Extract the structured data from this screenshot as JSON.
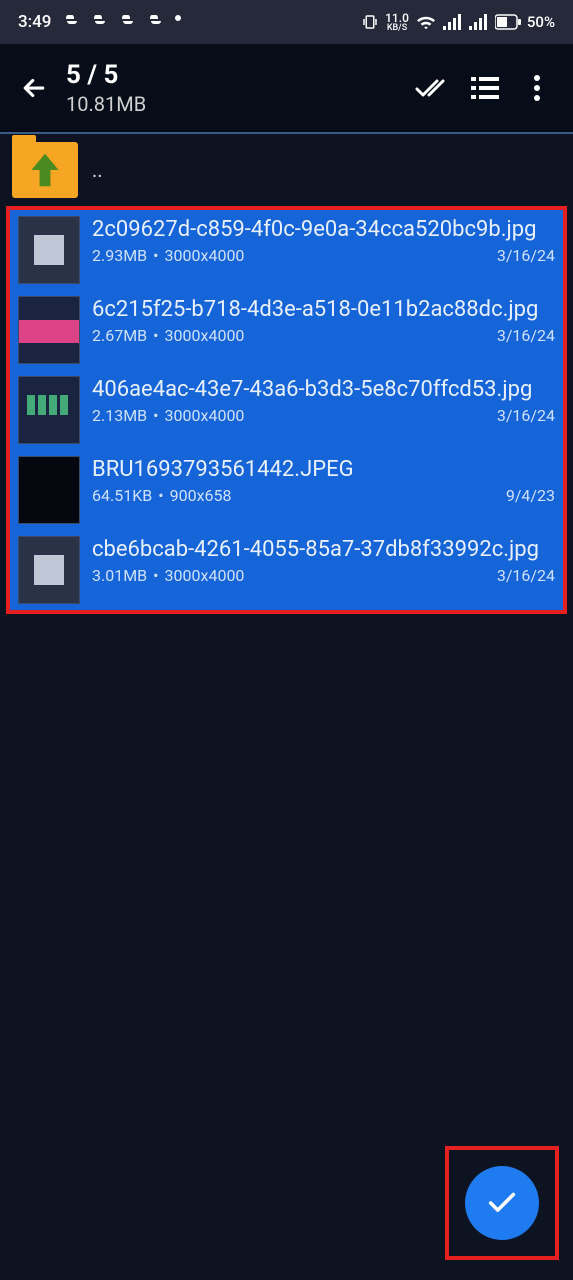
{
  "status": {
    "time": "3:49",
    "net_speed": "11.0",
    "net_unit": "KB/S",
    "battery": "50%"
  },
  "header": {
    "selection_count": "5 / 5",
    "total_size": "10.81MB"
  },
  "up_label": "..",
  "files": [
    {
      "name": "2c09627d-c859-4f0c-9e0a-34cca520bc9b.jpg",
      "size": "2.93MB",
      "dims": "3000x4000",
      "date": "3/16/24",
      "thumb": "qr"
    },
    {
      "name": "6c215f25-b718-4d3e-a518-0e11b2ac88dc.jpg",
      "size": "2.67MB",
      "dims": "3000x4000",
      "date": "3/16/24",
      "thumb": "photo"
    },
    {
      "name": "406ae4ac-43e7-43a6-b3d3-5e8c70ffcd53.jpg",
      "size": "2.13MB",
      "dims": "3000x4000",
      "date": "3/16/24",
      "thumb": "grid"
    },
    {
      "name": "BRU1693793561442.JPEG",
      "size": "64.51KB",
      "dims": "900x658",
      "date": "9/4/23",
      "thumb": "dark"
    },
    {
      "name": "cbe6bcab-4261-4055-85a7-37db8f33992c.jpg",
      "size": "3.01MB",
      "dims": "3000x4000",
      "date": "3/16/24",
      "thumb": "qr"
    }
  ]
}
